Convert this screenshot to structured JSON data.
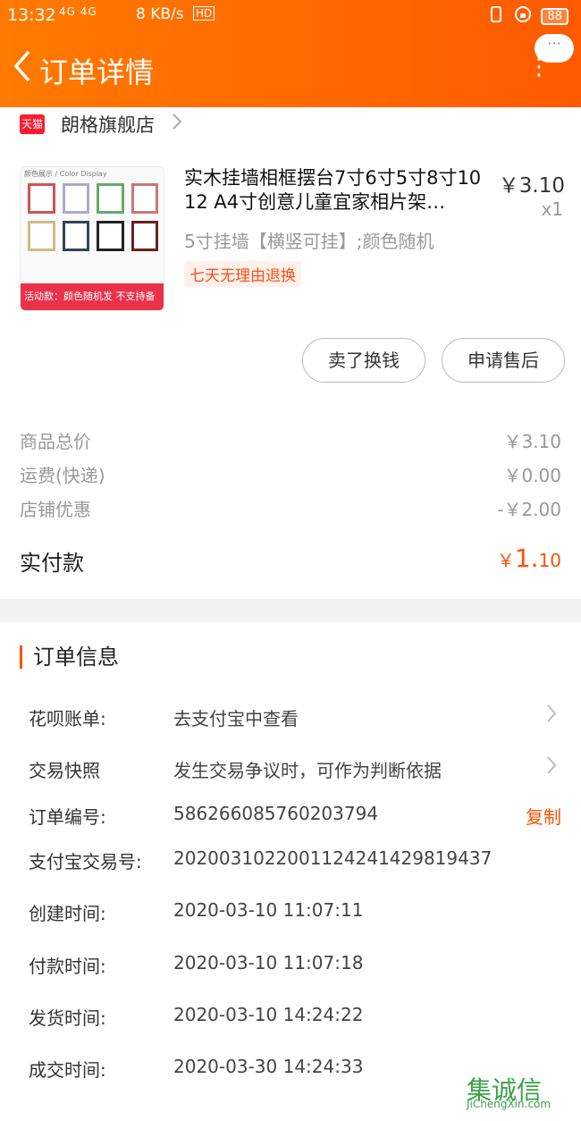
{
  "status_bar": {
    "time": "13:32",
    "signal": "4G 4G",
    "speed": "8 KB/s",
    "hd": "HD",
    "battery": "88"
  },
  "nav": {
    "title": "订单详情",
    "more_pill": "···",
    "more_dots": "⋮"
  },
  "shop": {
    "badge": "天猫",
    "name": "朗格旗舰店"
  },
  "product": {
    "thumb_top": "颜色展示 / Color Display",
    "thumb_bar": "活动款：颜色随机发 不支持备注",
    "title": "实木挂墙相框摆台7寸6寸5寸8寸10 12 A4寸创意儿童宜家相片架…",
    "price": "￥3.10",
    "qty": "x1",
    "spec": "5寸挂墙【横竖可挂】;颜色随机",
    "tag": "七天无理由退换"
  },
  "actions": {
    "sell": "卖了换钱",
    "after_sale": "申请售后"
  },
  "summary": {
    "total_label": "商品总价",
    "total_value": "￥3.10",
    "shipping_label": "运费(快递)",
    "shipping_value": "￥0.00",
    "discount_label": "店铺优惠",
    "discount_value": "-￥2.00",
    "paid_label": "实付款",
    "paid_currency": "￥",
    "paid_int": "1.",
    "paid_dec": "10"
  },
  "order_info": {
    "heading": "订单信息",
    "rows": [
      {
        "label": "花呗账单:",
        "value": "去支付宝中查看"
      },
      {
        "label": "交易快照",
        "value": "发生交易争议时，可作为判断依据"
      },
      {
        "label": "订单编号:",
        "value": "586266085760203794",
        "action": "复制"
      },
      {
        "label": "支付宝交易号:",
        "value": "2020031022001124241429819437"
      },
      {
        "label": "创建时间:",
        "value": "2020-03-10 11:07:11"
      },
      {
        "label": "付款时间:",
        "value": "2020-03-10 11:07:18"
      },
      {
        "label": "发货时间:",
        "value": "2020-03-10 14:24:22"
      },
      {
        "label": "成交时间:",
        "value": "2020-03-30 14:24:33"
      }
    ]
  },
  "watermark": {
    "main": "集诚信",
    "sub": "JiChengXin.com"
  },
  "colors": {
    "accent": "#ff5000",
    "header_start": "#ff7a00",
    "header_end": "#ff5a00"
  }
}
